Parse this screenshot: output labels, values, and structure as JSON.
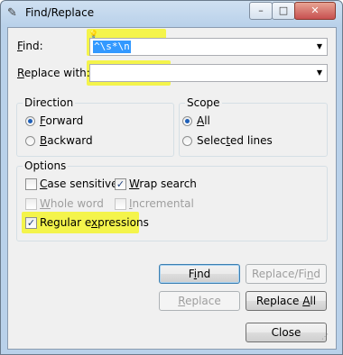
{
  "window": {
    "title": "Find/Replace",
    "controls": {
      "minimize": "–",
      "maximize": "□",
      "close": "✕"
    }
  },
  "find": {
    "label_u": "F",
    "label_rest": "ind:",
    "value": "^\\s*\\n"
  },
  "replace": {
    "label_pre": "R",
    "label_rest": "eplace with:",
    "value": ""
  },
  "direction": {
    "title": "Direction",
    "options": [
      {
        "u": "F",
        "rest": "orward",
        "selected": true
      },
      {
        "u": "B",
        "rest": "ackward",
        "selected": false
      }
    ]
  },
  "scope": {
    "title": "Scope",
    "options": [
      {
        "pre": "",
        "u": "A",
        "rest": "ll",
        "selected": true
      },
      {
        "pre": "Selec",
        "u": "t",
        "rest": "ed lines",
        "selected": false
      }
    ]
  },
  "options": {
    "title": "Options",
    "items": [
      {
        "pre": "",
        "u": "C",
        "rest": "ase sensitive",
        "checked": false,
        "enabled": true
      },
      {
        "pre": "",
        "u": "W",
        "rest": "rap search",
        "checked": true,
        "enabled": true
      },
      {
        "pre": "",
        "u": "W",
        "rest": "hole word",
        "checked": false,
        "enabled": false
      },
      {
        "pre": "",
        "u": "I",
        "rest": "ncremental",
        "checked": false,
        "enabled": false
      },
      {
        "pre": "Regular e",
        "u": "x",
        "rest": "pressions",
        "checked": true,
        "enabled": true
      }
    ]
  },
  "buttons": {
    "find": {
      "pre": "F",
      "u": "i",
      "rest": "nd"
    },
    "replace_find": {
      "pre": "Replace/Fi",
      "u": "n",
      "rest": "d"
    },
    "replace": {
      "pre": "",
      "u": "R",
      "rest": "eplace"
    },
    "replace_all": {
      "pre": "Replace ",
      "u": "A",
      "rest": "ll"
    },
    "close": "Close"
  },
  "colors": {
    "highlight": "#f5f52e",
    "selection": "#3399ff"
  }
}
